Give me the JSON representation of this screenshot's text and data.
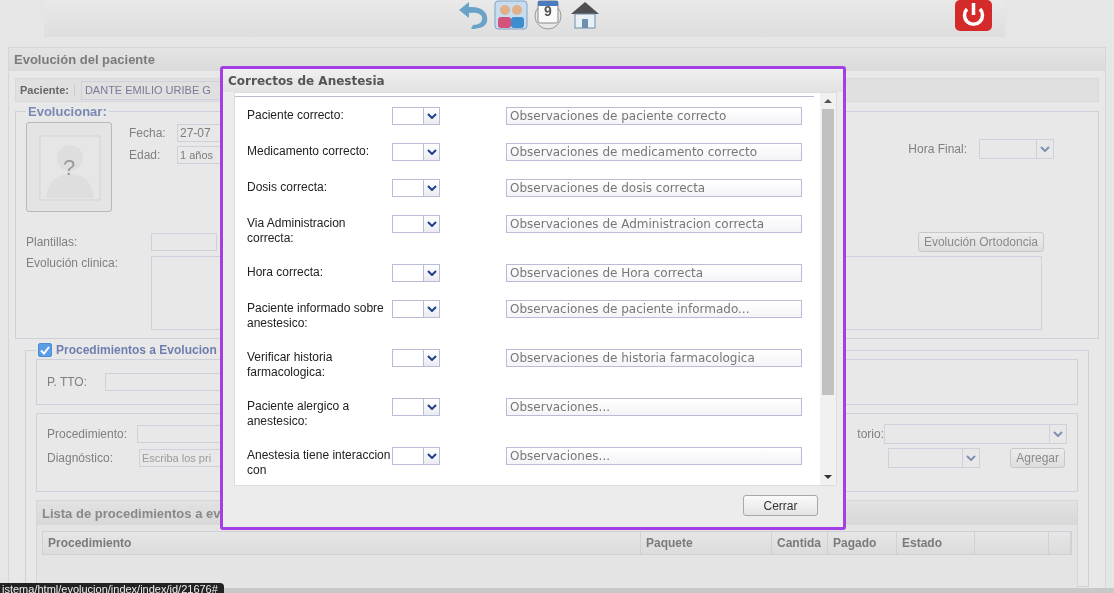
{
  "toolbar": {
    "calendar_day": "9"
  },
  "panel": {
    "title": "Evolución del paciente"
  },
  "patient": {
    "label": "Paciente:",
    "value": "DANTE EMILIO URIBE G"
  },
  "evolucionar": {
    "legend": "Evolucionar:",
    "fecha_label": "Fecha:",
    "fecha_value": "27-07",
    "edad_label": "Edad:",
    "edad_value": "1 años",
    "avatar_mark": "?",
    "hora_final_label": "Hora Final:",
    "plantillas_label": "Plantillas:",
    "ortodoncia_button": "Evolución Ortodoncia",
    "evolucion_label": "Evolución clinica:"
  },
  "procedimientos": {
    "legend": "Procedimientos a Evolucion",
    "checked": true,
    "ptto_label": "P. TTO:",
    "procedimiento_label": "Procedimiento:",
    "diagnostico_label": "Diagnóstico:",
    "diagnostico_placeholder": "Escriba los pri",
    "consultorio_label": "torio:",
    "add_button": "Agregar"
  },
  "list": {
    "title": "Lista de procedimientos a ev",
    "columns": [
      "Procedimiento",
      "Paquete",
      "Cantida",
      "Pagado",
      "Estado"
    ]
  },
  "status_url": "istema/html/evolucion/index/index/id/21676#",
  "dialog": {
    "title": "Correctos de Anestesia",
    "close_button": "Cerrar",
    "rows": [
      {
        "label": "Paciente correcto:",
        "placeholder": "Observaciones de paciente correcto"
      },
      {
        "label": "Medicamento correcto:",
        "placeholder": "Observaciones de medicamento correcto"
      },
      {
        "label": "Dosis correcta:",
        "placeholder": "Observaciones de dosis correcta"
      },
      {
        "label": "Via Administracion correcta:",
        "placeholder": "Observaciones de Administracion correcta"
      },
      {
        "label": "Hora correcta:",
        "placeholder": "Observaciones de Hora correcta"
      },
      {
        "label": "Paciente informado sobre anestesico:",
        "placeholder": "Observaciones de paciente informado..."
      },
      {
        "label": "Verificar historia farmacologica:",
        "placeholder": "Observaciones de historia farmacologica"
      },
      {
        "label": "Paciente alergico a anestesico:",
        "placeholder": "Observaciones..."
      },
      {
        "label": "Anestesia tiene interaccion con",
        "placeholder": "Observaciones..."
      }
    ]
  }
}
